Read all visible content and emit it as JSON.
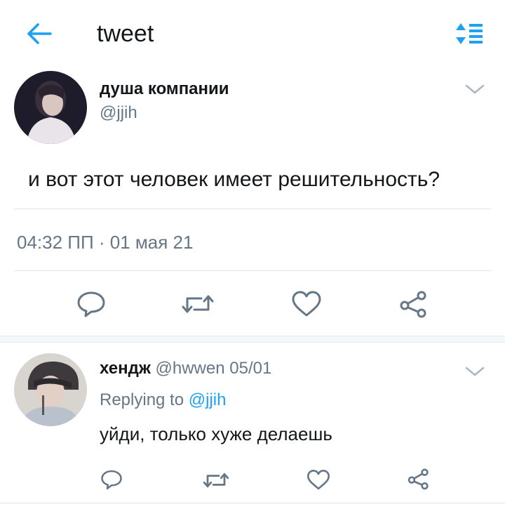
{
  "header": {
    "title": "tweet",
    "back_icon": "arrow-left-icon",
    "sort_icon": "sort-list-icon",
    "accent_color": "#1da1f2"
  },
  "main_tweet": {
    "author_name": "душа компании",
    "author_handle": "@jjih",
    "text": "и вот этот человек имеет решительность?",
    "timestamp": "04:32 ПП · 01 мая 21",
    "actions": [
      "reply-icon",
      "retweet-icon",
      "like-icon",
      "share-icon"
    ]
  },
  "reply": {
    "author_name": "хендж",
    "author_handle": "@hwwen",
    "date": "05/01",
    "replying_to_label": "Replying to",
    "replying_to_handle": "@jjih",
    "text": "уйди, только хуже делаешь",
    "actions": [
      "reply-icon",
      "retweet-icon",
      "like-icon",
      "share-icon"
    ]
  },
  "colors": {
    "text_primary": "#14171a",
    "text_secondary": "#657786",
    "icon_gray": "#657786",
    "link_blue": "#1da1f2",
    "divider": "#e1e8ed"
  }
}
